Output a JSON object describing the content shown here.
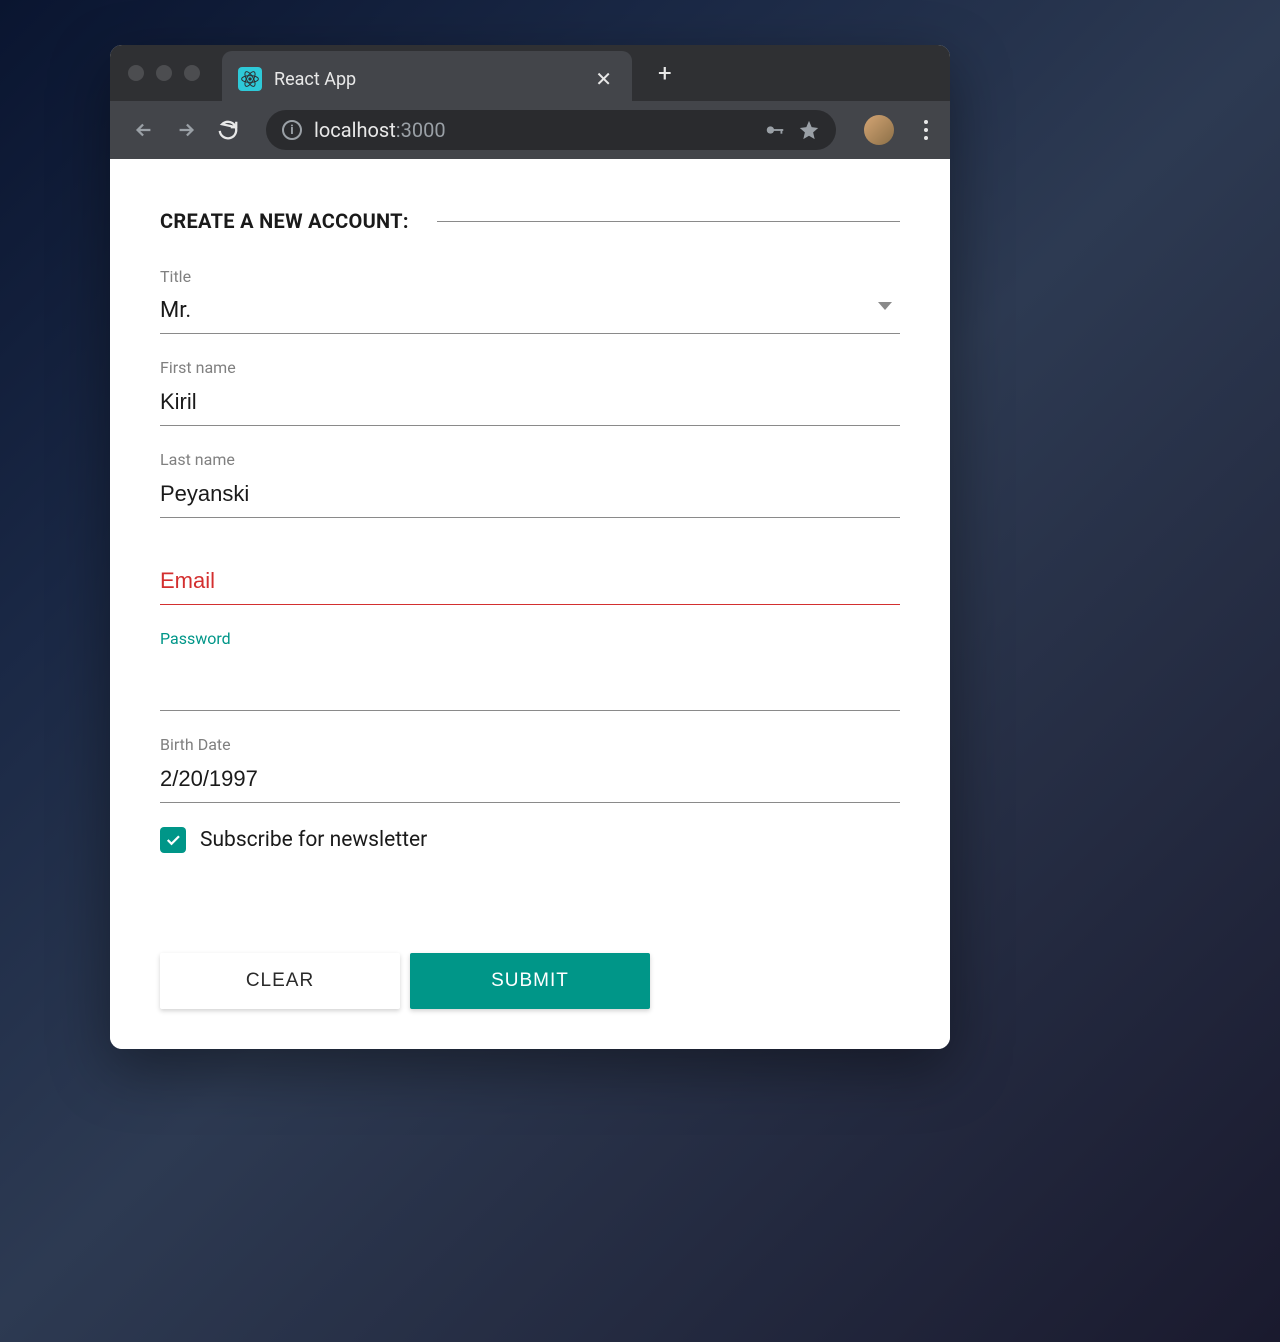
{
  "browser": {
    "tab_title": "React App",
    "url_host": "localhost",
    "url_port": ":3000"
  },
  "form": {
    "header": "CREATE A NEW ACCOUNT:",
    "fields": {
      "title": {
        "label": "Title",
        "value": "Mr."
      },
      "first_name": {
        "label": "First name",
        "value": "Kiril"
      },
      "last_name": {
        "label": "Last name",
        "value": "Peyanski"
      },
      "email": {
        "label": "Email",
        "value": ""
      },
      "password": {
        "label": "Password",
        "value": ""
      },
      "birth_date": {
        "label": "Birth Date",
        "value": "2/20/1997"
      }
    },
    "newsletter": {
      "label": "Subscribe for newsletter",
      "checked": true
    },
    "buttons": {
      "clear": "CLEAR",
      "submit": "SUBMIT"
    }
  },
  "colors": {
    "accent": "#009688",
    "error": "#d32f2f"
  }
}
